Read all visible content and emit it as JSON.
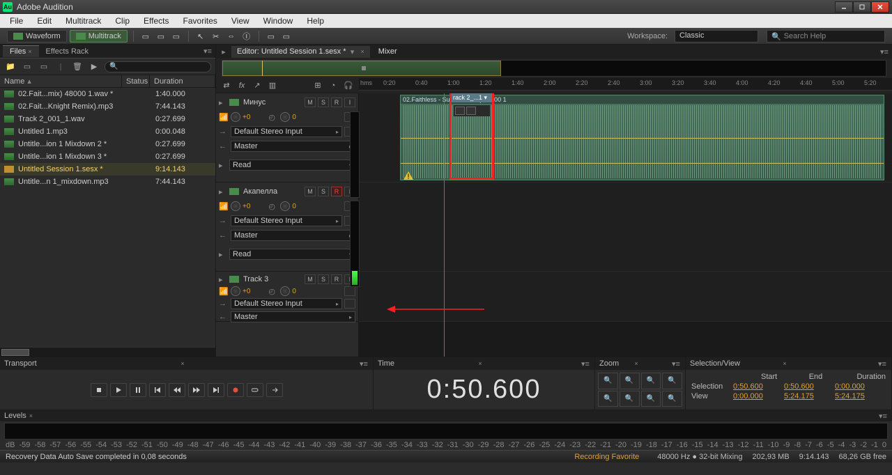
{
  "title": "Adobe Audition",
  "app_logo": "Au",
  "menubar": [
    "File",
    "Edit",
    "Multitrack",
    "Clip",
    "Effects",
    "Favorites",
    "View",
    "Window",
    "Help"
  ],
  "modes": {
    "waveform": "Waveform",
    "multitrack": "Multitrack"
  },
  "workspace": {
    "label": "Workspace:",
    "value": "Classic"
  },
  "search_placeholder": "Search Help",
  "files_panel": {
    "tabs": [
      "Files",
      "Effects Rack"
    ],
    "columns": {
      "name": "Name",
      "status": "Status",
      "duration": "Duration"
    },
    "rows": [
      {
        "name": "02.Fait...mix) 48000 1.wav *",
        "status": "",
        "dur": "1:40.000",
        "type": "wav"
      },
      {
        "name": "02.Fait...Knight Remix).mp3",
        "status": "",
        "dur": "7:44.143",
        "type": "wav"
      },
      {
        "name": "Track 2_001_1.wav",
        "status": "",
        "dur": "0:27.699",
        "type": "wav"
      },
      {
        "name": "Untitled 1.mp3",
        "status": "",
        "dur": "0:00.048",
        "type": "wav"
      },
      {
        "name": "Untitle...ion 1 Mixdown 2 *",
        "status": "",
        "dur": "0:27.699",
        "type": "wav"
      },
      {
        "name": "Untitle...ion 1 Mixdown 3 *",
        "status": "",
        "dur": "0:27.699",
        "type": "wav"
      },
      {
        "name": "Untitled Session 1.sesx *",
        "status": "",
        "dur": "9:14.143",
        "type": "sesx",
        "selected": true
      },
      {
        "name": "Untitle...n 1_mixdown.mp3",
        "status": "",
        "dur": "7:44.143",
        "type": "wav"
      }
    ]
  },
  "editor": {
    "tabs": [
      {
        "label": "Editor: Untitled Session 1.sesx *",
        "active": true
      },
      {
        "label": "Mixer"
      }
    ],
    "ruler_unit": "hms",
    "ruler_marks": [
      "0:20",
      "0:40",
      "1:00",
      "1:20",
      "1:40",
      "2:00",
      "2:20",
      "2:40",
      "3:00",
      "3:20",
      "3:40",
      "4:00",
      "4:20",
      "4:40",
      "5:00",
      "5:20"
    ],
    "tracks": [
      {
        "name": "Минус",
        "vol": "+0",
        "pan": "0",
        "input": "Default Stereo Input",
        "output": "Master",
        "read": "Read",
        "rec": false
      },
      {
        "name": "Акапелла",
        "vol": "+0",
        "pan": "0",
        "input": "Default Stereo Input",
        "output": "Master",
        "read": "Read",
        "rec": true
      },
      {
        "name": "Track 3",
        "vol": "+0",
        "pan": "0",
        "input": "Default Stereo Input",
        "output": "Master",
        "read": "",
        "rec": false
      }
    ],
    "btns": {
      "m": "M",
      "s": "S",
      "r": "R",
      "i": "I"
    },
    "clip1_label": "02.Faithless - Sun              ht Remix) 48000 1",
    "red_clip_label": "rack 2_...1 ▾"
  },
  "transport": {
    "title": "Transport"
  },
  "time": {
    "title": "Time",
    "value": "0:50.600"
  },
  "zoom": {
    "title": "Zoom"
  },
  "selview": {
    "title": "Selection/View",
    "cols": {
      "start": "Start",
      "end": "End",
      "dur": "Duration"
    },
    "rows": [
      {
        "label": "Selection",
        "start": "0:50.600",
        "end": "0:50.600",
        "dur": "0:00.000"
      },
      {
        "label": "View",
        "start": "0:00.000",
        "end": "5:24.175",
        "dur": "5:24.175"
      }
    ]
  },
  "levels": {
    "title": "Levels",
    "scale": [
      "dB",
      "-59",
      "-58",
      "-57",
      "-56",
      "-55",
      "-54",
      "-53",
      "-52",
      "-51",
      "-50",
      "-49",
      "-48",
      "-47",
      "-46",
      "-45",
      "-44",
      "-43",
      "-42",
      "-41",
      "-40",
      "-39",
      "-38",
      "-37",
      "-36",
      "-35",
      "-34",
      "-33",
      "-32",
      "-31",
      "-30",
      "-29",
      "-28",
      "-27",
      "-26",
      "-25",
      "-24",
      "-23",
      "-22",
      "-21",
      "-20",
      "-19",
      "-18",
      "-17",
      "-16",
      "-15",
      "-14",
      "-13",
      "-12",
      "-11",
      "-10",
      "-9",
      "-8",
      "-7",
      "-6",
      "-5",
      "-4",
      "-3",
      "-2",
      "-1",
      "0"
    ]
  },
  "status": {
    "left": "Recovery Data Auto Save completed in 0,08 seconds",
    "fav": "Recording Favorite",
    "sample": "48000 Hz ● 32-bit Mixing",
    "mem": "202,93 MB",
    "dur": "9:14.143",
    "disk": "68,26 GB free"
  }
}
